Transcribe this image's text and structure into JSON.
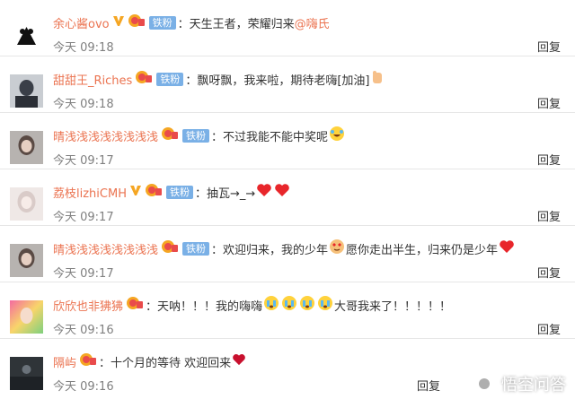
{
  "colors": {
    "username": "#eb7350",
    "badge_bg": "#7ab0e6",
    "time": "#808080",
    "mention": "#eb7350"
  },
  "comments": [
    {
      "username": "余心酱ovo",
      "verified": true,
      "badge": "铁粉",
      "text": "天生王者，荣耀归来",
      "mention": "@嗨氏",
      "time": "今天 09:18",
      "reply": "回复",
      "emoji": []
    },
    {
      "username": "甜甜王_Riches",
      "verified": false,
      "badge": "铁粉",
      "text": "飘呀飘，我来啦，期待老嗨[加油]",
      "mention": "",
      "time": "今天 09:18",
      "reply": "回复",
      "emoji": [
        "fist-emoji"
      ]
    },
    {
      "username": "晴浅浅浅浅浅浅浅浅",
      "verified": false,
      "badge": "铁粉",
      "text": "不过我能不能中奖呢",
      "mention": "",
      "time": "今天 09:17",
      "reply": "回复",
      "emoji": [
        "laugh-tears-emoji"
      ]
    },
    {
      "username": "荔枝lizhiCMH",
      "verified": true,
      "badge": "铁粉",
      "text": "抽瓦→_→",
      "mention": "",
      "time": "今天 09:17",
      "reply": "回复",
      "emoji": [
        "heart-emoji",
        "heart-emoji"
      ]
    },
    {
      "username": "晴浅浅浅浅浅浅浅浅",
      "verified": false,
      "badge": "铁粉",
      "text_a": "欢迎归来，我的少年",
      "text_b": "愿你走出半生，归来仍是少年",
      "time": "今天 09:17",
      "reply": "回复",
      "emoji": [
        "heart-eyes-emoji",
        "heart-emoji"
      ]
    },
    {
      "username": "欣欣也非狒狒",
      "verified": false,
      "badge": "",
      "text_a": "天呐！！！我的嗨嗨",
      "text_b": "大哥我来了！！！！！",
      "time": "今天 09:16",
      "reply": "回复",
      "emoji": [
        "crying-emoji",
        "crying-emoji",
        "crying-emoji",
        "crying-emoji"
      ]
    },
    {
      "username": "隔屿",
      "verified": false,
      "badge": "",
      "text": "十个月的等待 欢迎回来",
      "mention": "",
      "time": "今天 09:16",
      "reply": "回复",
      "emoji": [
        "heart-emoji"
      ]
    }
  ],
  "watermark": "悟空问答"
}
